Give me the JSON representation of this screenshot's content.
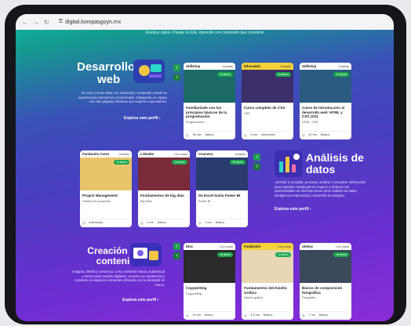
{
  "browser": {
    "url": "digital.kompasgoyn.mx",
    "lock_icon": "lock-icon"
  },
  "intro_text": "Analizar datos. Pásale la lista. Aprende con contenido que convierte",
  "sections": [
    {
      "title_line1": "Desarrollo",
      "title_line2": "web",
      "description": "De cero a crear sitios con JavaScript. Contenido creado en experiencias interactivas y funcionales, trabajando en equipo con más páginas efectivas que superen expectativas.",
      "link": "Explora este perfil",
      "cards": [
        {
          "provider": "skillshop",
          "badge": "Gratuito",
          "pill": "Ya tienes",
          "title": "Familiarízate con los principios básicos de la programación",
          "category": "Programación",
          "foot1": "38 min",
          "foot2": "Básico",
          "thumb": "#1c6b66"
        },
        {
          "provider": "Educamás",
          "badge": "Gratuito",
          "pill": "Ya tienes",
          "title": "Curso completo de CSS",
          "category": "CSS",
          "foot1": "3 hrs",
          "foot2": "Intermedio",
          "thumb": "#3d2f6a"
        },
        {
          "provider": "skillshop",
          "badge": "Gratuito",
          "pill": "Ya tienes",
          "title": "Curso de introducción al desarrollo web: HTML y CSS (1/2)",
          "category": "HTML, CSS",
          "foot1": "40 hrs",
          "foot2": "Básico",
          "thumb": "#2a5c80"
        }
      ]
    },
    {
      "title_line1": "Análisis de",
      "title_line2": "datos",
      "description": "Aprende a recopilar, procesar, analizar y visualizar información para impulsar estrategias de negocio y detectar las oportunidades en diversas áreas como análisis de datos, inteligencia empresarial y desarrollo tecnológico.",
      "link": "Explora este perfil",
      "cards": [
        {
          "provider": "Fundación Carso",
          "badge": "Gratuito",
          "pill": "Ya tienes",
          "title": "Project Management",
          "category": "Gestión de proyectos",
          "foot1": "Intermedio",
          "foot2": "",
          "thumb": "#e8c46a"
        },
        {
          "provider": "LinkedIn",
          "badge": "Con costo",
          "pill": "Ya tienes",
          "title": "Fundamentos de big data",
          "category": "Big Data",
          "foot1": "2 hrs",
          "foot2": "Básico",
          "thumb": "#7a2b3a"
        },
        {
          "provider": "Coursera",
          "badge": "Gratuito",
          "pill": "Ya tienes",
          "title": "De Excel hasta Power BI",
          "category": "Power BI",
          "foot1": "2 hrs",
          "foot2": "Básico",
          "thumb": "#2a3b70"
        }
      ]
    },
    {
      "title_line1": "Creación de",
      "title_line2": "contenido",
      "description": "Imagina, diseña y comunica. Crea contenido visual, audiovisual y escrito para medios digitales, conecta con audiencias y convierte en espacios relevantes afinando con tu identidad de marca.",
      "link": "Explora este perfil",
      "cards": [
        {
          "provider": "Etoc",
          "badge": "Con costo",
          "pill": "Ya tienes",
          "title": "Copywriting",
          "category": "Copywriting",
          "foot1": "10 hrs",
          "foot2": "Básico",
          "thumb": "#2b2b2b"
        },
        {
          "provider": "Fundación",
          "badge": "Con costo",
          "pill": "Ya tienes",
          "title": "Fundamentos del Diseño Gráfico",
          "category": "Diseño gráfico",
          "foot1": "4.5 hrs",
          "foot2": "Básico",
          "thumb": "#e7d7b2"
        },
        {
          "provider": "Udemy",
          "badge": "Con costo",
          "pill": "Ya tienes",
          "title": "Básico de composición fotográfica",
          "category": "Fotografía",
          "foot1": "7 hrs",
          "foot2": "Básico",
          "thumb": "#3b4a5a"
        }
      ]
    }
  ]
}
